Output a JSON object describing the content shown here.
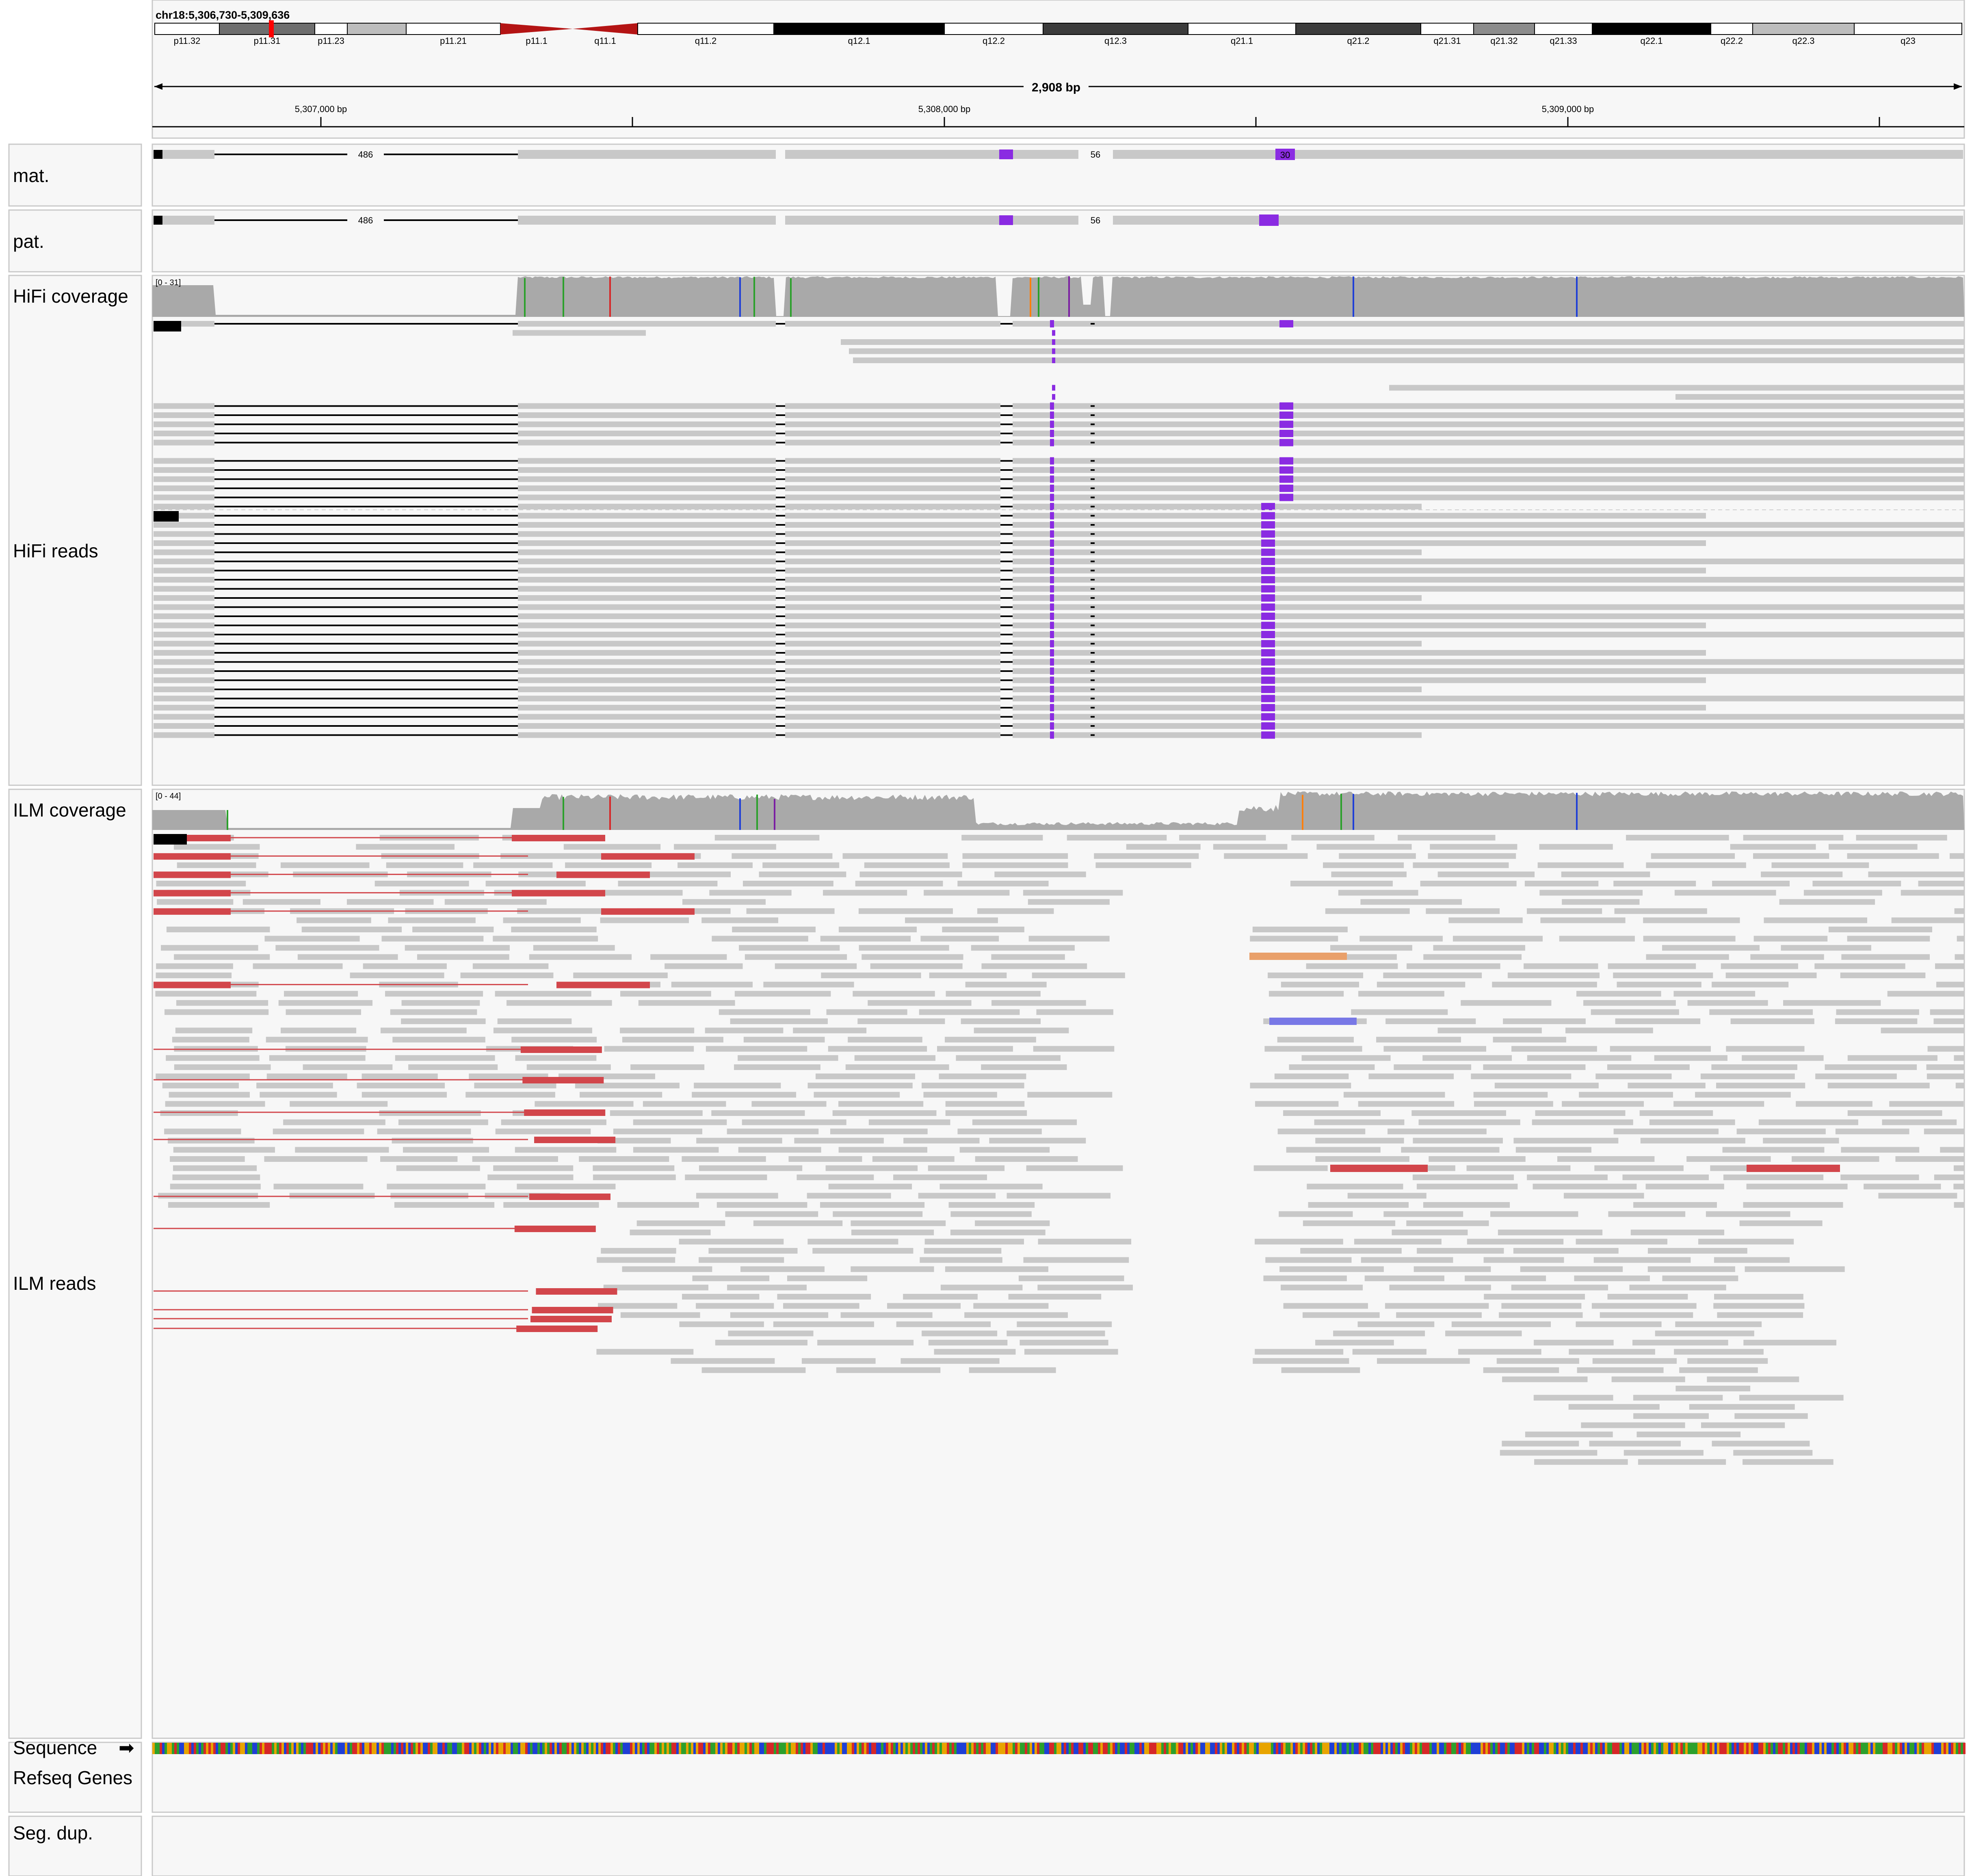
{
  "locus": "chr18:5,306,730-5,309,636",
  "ruler": {
    "span_label": "2,908 bp",
    "tick_labels": [
      "5,307,000 bp",
      "5,308,000 bp",
      "5,309,000 bp"
    ]
  },
  "ideogram": {
    "bands": [
      {
        "label": "p11.32",
        "stain": "white"
      },
      {
        "label": "p11.31",
        "stain": "dark"
      },
      {
        "label": "p11.23",
        "stain": "white"
      },
      {
        "label": "",
        "stain": "light"
      },
      {
        "label": "p11.21",
        "stain": "white"
      },
      {
        "label": "p11.1",
        "stain": "centromere"
      },
      {
        "label": "q11.1",
        "stain": "centromere"
      },
      {
        "label": "q11.2",
        "stain": "white"
      },
      {
        "label": "q12.1",
        "stain": "black"
      },
      {
        "label": "q12.2",
        "stain": "white"
      },
      {
        "label": "q12.3",
        "stain": "darker"
      },
      {
        "label": "q21.1",
        "stain": "white"
      },
      {
        "label": "q21.2",
        "stain": "darker"
      },
      {
        "label": "q21.31",
        "stain": "white"
      },
      {
        "label": "q21.32",
        "stain": "mid"
      },
      {
        "label": "q21.33",
        "stain": "white"
      },
      {
        "label": "q22.1",
        "stain": "black"
      },
      {
        "label": "q22.2",
        "stain": "white"
      },
      {
        "label": "q22.3",
        "stain": "light"
      },
      {
        "label": "q23",
        "stain": "white"
      }
    ]
  },
  "tracks": {
    "mat": {
      "label": "mat.",
      "insertion_labels": [
        "486",
        "56",
        "30"
      ]
    },
    "pat": {
      "label": "pat.",
      "insertion_labels": [
        "486",
        "56"
      ]
    },
    "hifi_coverage": {
      "label": "HiFi coverage",
      "range": "[0 - 31]"
    },
    "hifi_reads": {
      "label": "HiFi reads"
    },
    "ilm_coverage": {
      "label": "ILM coverage",
      "range": "[0 - 44]"
    },
    "ilm_reads": {
      "label": "ILM reads"
    },
    "sequence": {
      "label": "Sequence",
      "arrow": "➡"
    },
    "refseq": {
      "label": "Refseq Genes"
    },
    "segdup": {
      "label": "Seg. dup."
    }
  },
  "colors": {
    "read": "#c8c8c8",
    "coverage": "#a9a9a9",
    "insertion": "#8a2be2",
    "discordant": "#d2464b",
    "centromere": "#b41414",
    "border": "#c9c9c9",
    "panel": "#f7f7f7"
  }
}
